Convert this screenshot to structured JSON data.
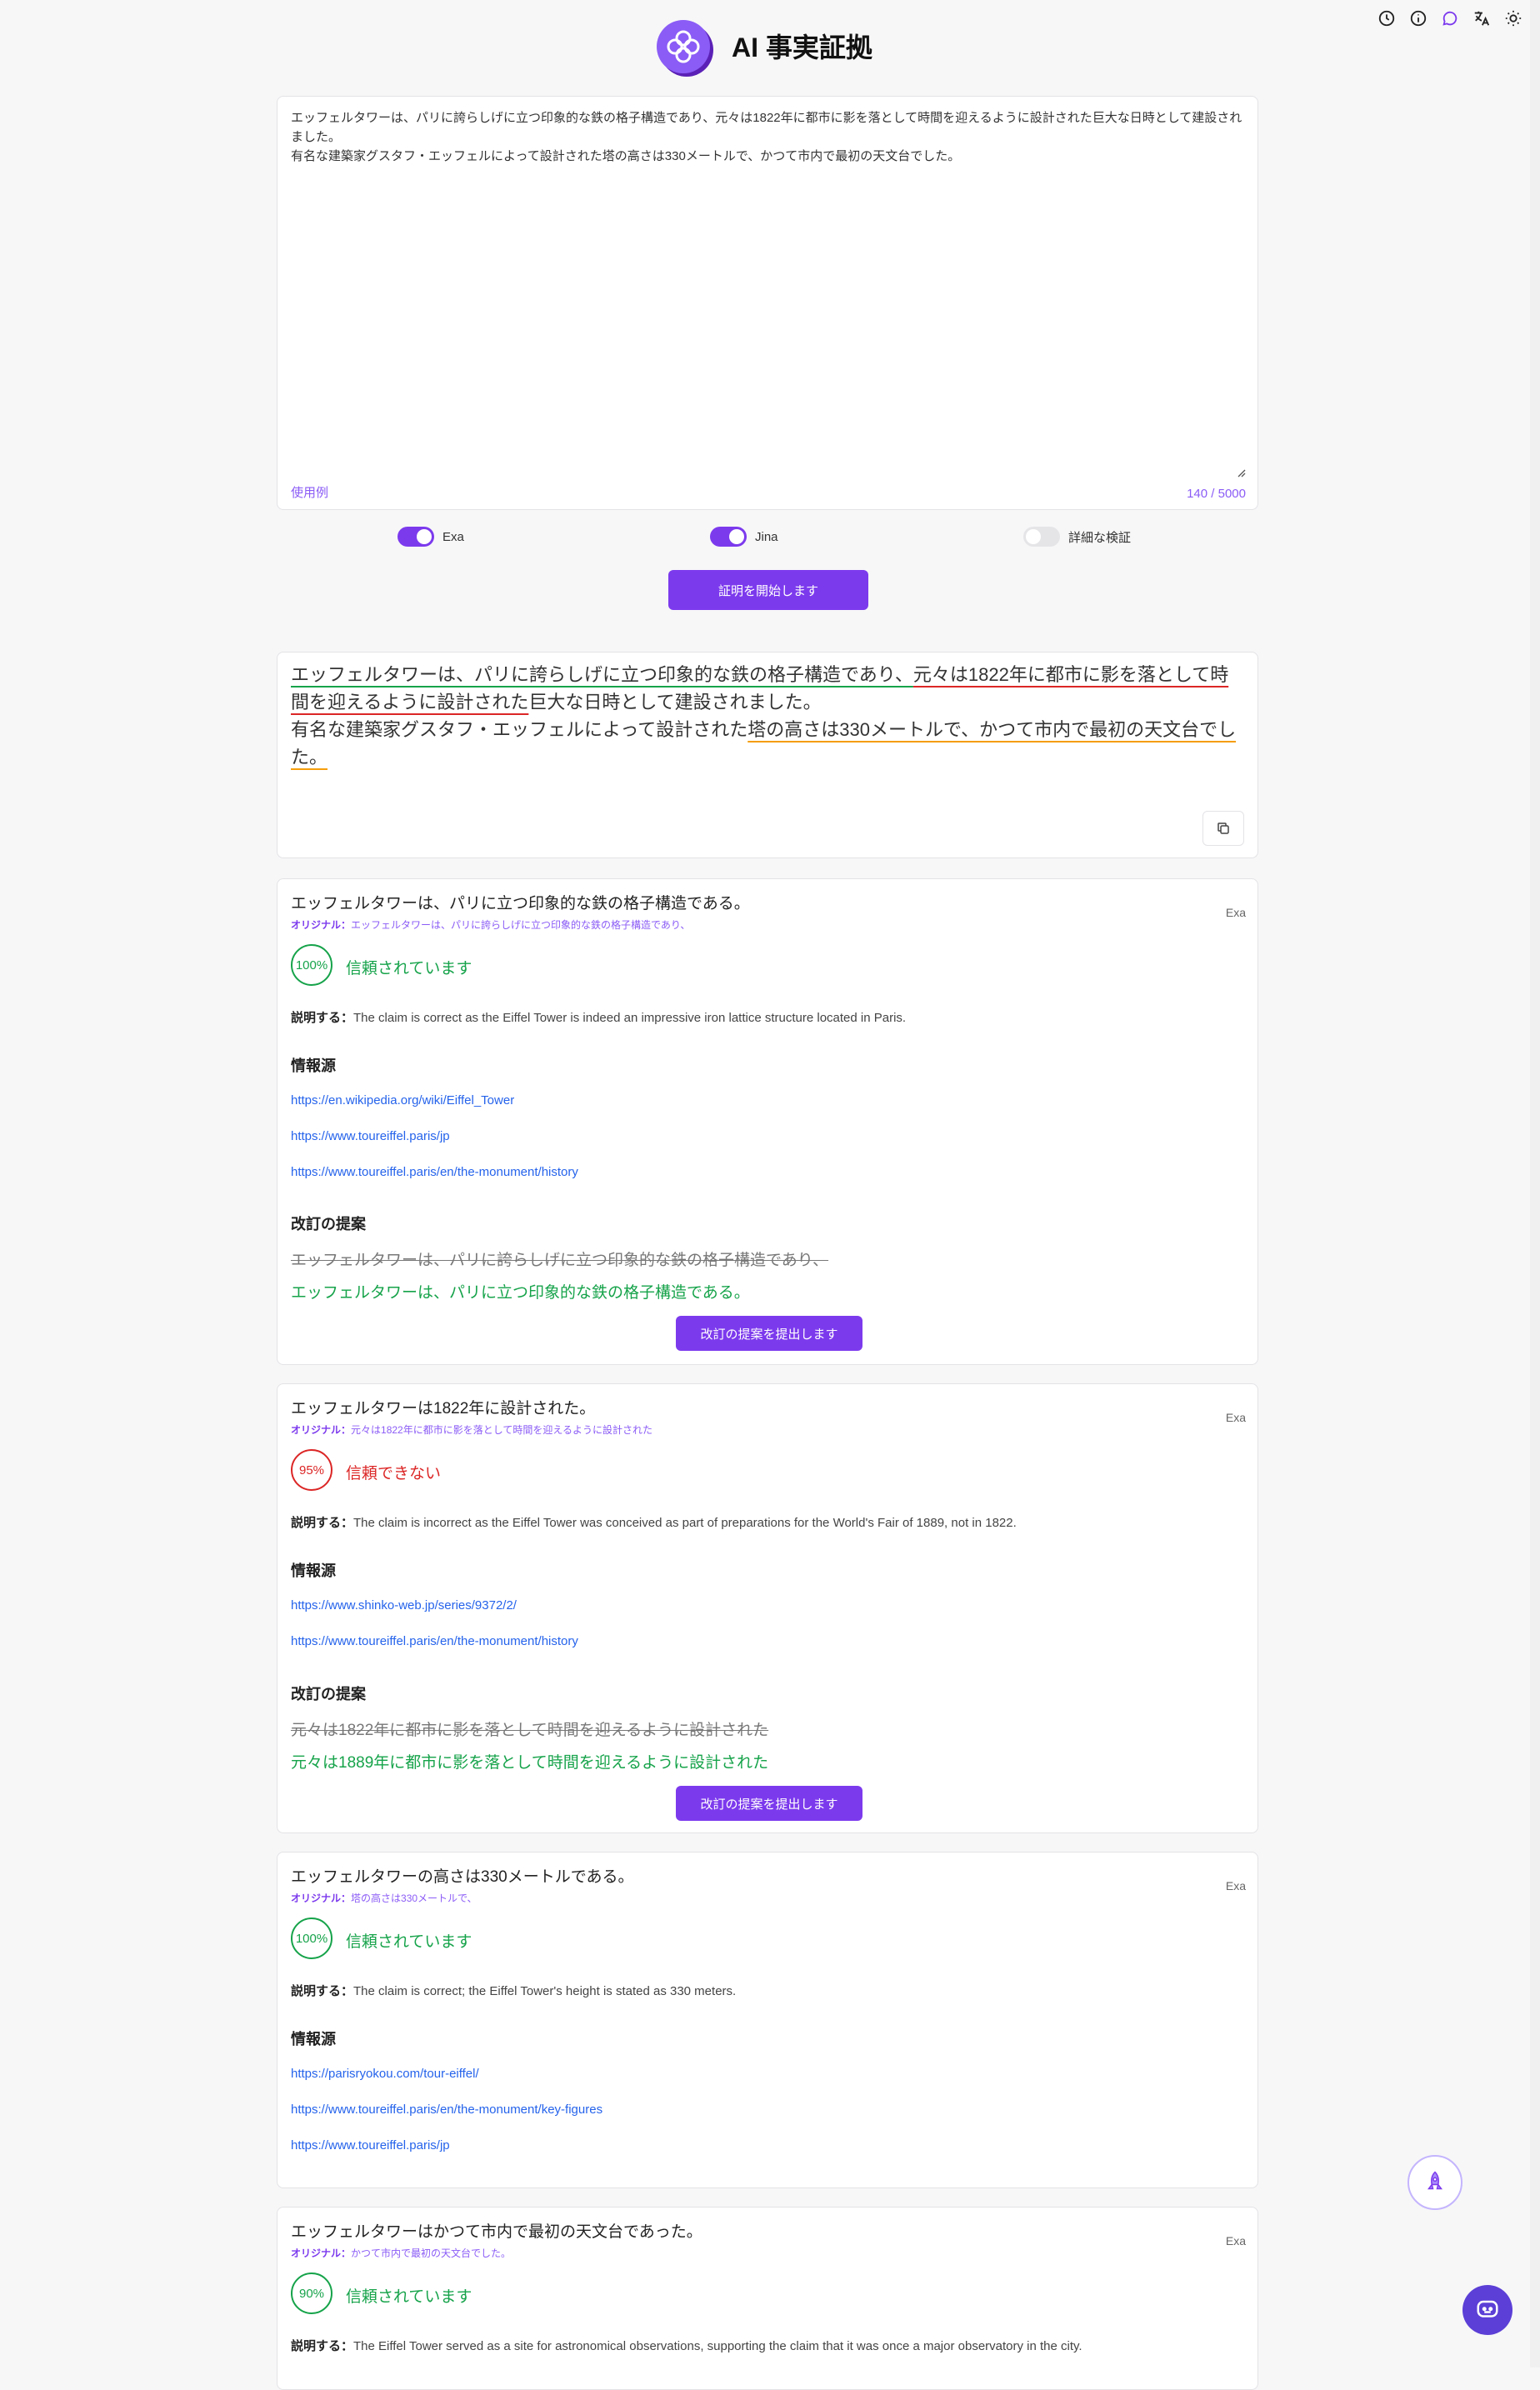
{
  "header": {
    "title": "AI 事実証拠",
    "icons": [
      "history-icon",
      "info-icon",
      "chat-bubble-icon",
      "translate-icon",
      "theme-sun-icon"
    ]
  },
  "input": {
    "text": "エッフェルタワーは、パリに誇らしげに立つ印象的な鉄の格子構造であり、元々は1822年に都市に影を落として時間を迎えるように設計された巨大な日時として建設されました。\n有名な建築家グスタフ・エッフェルによって設計された塔の高さは330メートルで、かつて市内で最初の天文台でした。",
    "example_link": "使用例",
    "char_count": "140 / 5000"
  },
  "toggles": [
    {
      "label": "Exa",
      "on": true
    },
    {
      "label": "Jina",
      "on": true
    },
    {
      "label": "詳細な検証",
      "on": false
    }
  ],
  "start_button": "証明を開始します",
  "highlight": {
    "s1": "エッフェルタワーは、パリに誇らしげに立つ印象的な鉄の格子構造であり、",
    "s2": "元々は1822年に都市に影を落として時間を迎えるように設計された",
    "s3": "巨大な日時として建設されました。",
    "s4": "有名な建築家グスタフ・エッフェルによって設計された",
    "s5": "塔の高さは330メートルで、かつて市内で最初の天文台でした。"
  },
  "labels": {
    "original": "オリジナル：",
    "explain": "説明する：",
    "sources": "情報源",
    "revision": "改訂の提案",
    "submit": "改訂の提案を提出します"
  },
  "claims": [
    {
      "title": "エッフェルタワーは、パリに立つ印象的な鉄の格子構造である。",
      "original": "エッフェルタワーは、パリに誇らしげに立つ印象的な鉄の格子構造であり、",
      "engine": "Exa",
      "score": "100%",
      "verdict": "信頼されています",
      "explanation": "The claim is correct as the Eiffel Tower is indeed an impressive iron lattice structure located in Paris.",
      "sources": [
        "https://en.wikipedia.org/wiki/Eiffel_Tower",
        "https://www.toureiffel.paris/jp",
        "https://www.toureiffel.paris/en/the-monument/history"
      ],
      "revision_old": "エッフェルタワーは、パリに誇らしげに立つ印象的な鉄の格子構造であり、",
      "revision_new": "エッフェルタワーは、パリに立つ印象的な鉄の格子構造である。"
    },
    {
      "title": "エッフェルタワーは1822年に設計された。",
      "original": "元々は1822年に都市に影を落として時間を迎えるように設計された",
      "engine": "Exa",
      "score": "95%",
      "verdict": "信頼できない",
      "explanation": "The claim is incorrect as the Eiffel Tower was conceived as part of preparations for the World's Fair of 1889, not in 1822.",
      "sources": [
        "https://www.shinko-web.jp/series/9372/2/",
        "https://www.toureiffel.paris/en/the-monument/history"
      ],
      "revision_old": "元々は1822年に都市に影を落として時間を迎えるように設計された",
      "revision_new": "元々は1889年に都市に影を落として時間を迎えるように設計された"
    },
    {
      "title": "エッフェルタワーの高さは330メートルである。",
      "original": "塔の高さは330メートルで、",
      "engine": "Exa",
      "score": "100%",
      "verdict": "信頼されています",
      "explanation": "The claim is correct; the Eiffel Tower's height is stated as 330 meters.",
      "sources": [
        "https://parisryokou.com/tour-eiffel/",
        "https://www.toureiffel.paris/en/the-monument/key-figures",
        "https://www.toureiffel.paris/jp"
      ]
    },
    {
      "title": "エッフェルタワーはかつて市内で最初の天文台であった。",
      "original": "かつて市内で最初の天文台でした。",
      "engine": "Exa",
      "score": "90%",
      "verdict": "信頼されています",
      "explanation": "The Eiffel Tower served as a site for astronomical observations, supporting the claim that it was once a major observatory in the city."
    }
  ]
}
